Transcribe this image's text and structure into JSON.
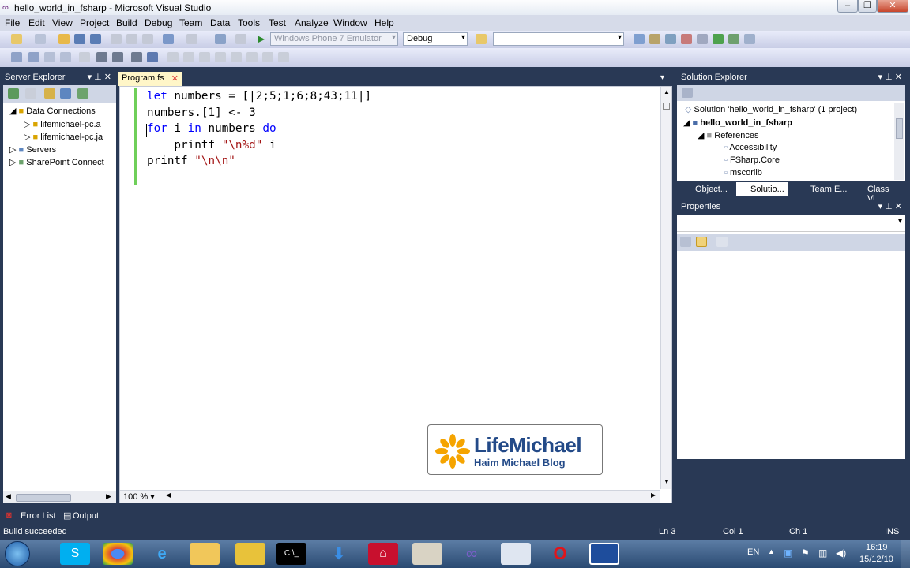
{
  "window": {
    "title": "hello_world_in_fsharp - Microsoft Visual Studio"
  },
  "menu": [
    "File",
    "Edit",
    "View",
    "Project",
    "Build",
    "Debug",
    "Team",
    "Data",
    "Tools",
    "Test",
    "Analyze",
    "Window",
    "Help"
  ],
  "toolbar": {
    "platform": "Windows Phone 7 Emulator",
    "config": "Debug",
    "find": ""
  },
  "server_explorer": {
    "title": "Server Explorer",
    "items": [
      "Data Connections",
      "lifemichael-pc.a",
      "lifemichael-pc.ja",
      "Servers",
      "SharePoint Connect"
    ]
  },
  "editor": {
    "tab": "Program.fs",
    "zoom": "100 %",
    "lines": [
      {
        "kw": "let",
        "rest": " numbers = [|2;5;1;6;8;43;11|]"
      },
      {
        "text": "numbers.[1] <- 3"
      },
      {
        "kw": "for",
        "mid1": " i ",
        "kw2": "in",
        "mid2": " numbers ",
        "kw3": "do"
      },
      {
        "fn": "    printf ",
        "str": "\"\\n%d\"",
        "tail": " i"
      },
      {
        "fn": "printf ",
        "str": "\"\\n\\n\""
      }
    ]
  },
  "watermark": {
    "brand": "LifeMichael",
    "subtitle": "Haim Michael Blog"
  },
  "solution_explorer": {
    "title": "Solution Explorer",
    "items": [
      "Solution 'hello_world_in_fsharp' (1 project)",
      "hello_world_in_fsharp",
      "References",
      "Accessibility",
      "FSharp.Core",
      "mscorlib"
    ],
    "tabs": [
      "Object...",
      "Solutio...",
      "Team E...",
      "Class Vi..."
    ]
  },
  "properties": {
    "title": "Properties"
  },
  "bottom_tabs": [
    "Error List",
    "Output"
  ],
  "status": {
    "message": "Build succeeded",
    "ln": "Ln 3",
    "col": "Col 1",
    "ch": "Ch 1",
    "ins": "INS"
  },
  "tray": {
    "lang": "EN",
    "time": "16:19",
    "date": "15/12/10"
  }
}
